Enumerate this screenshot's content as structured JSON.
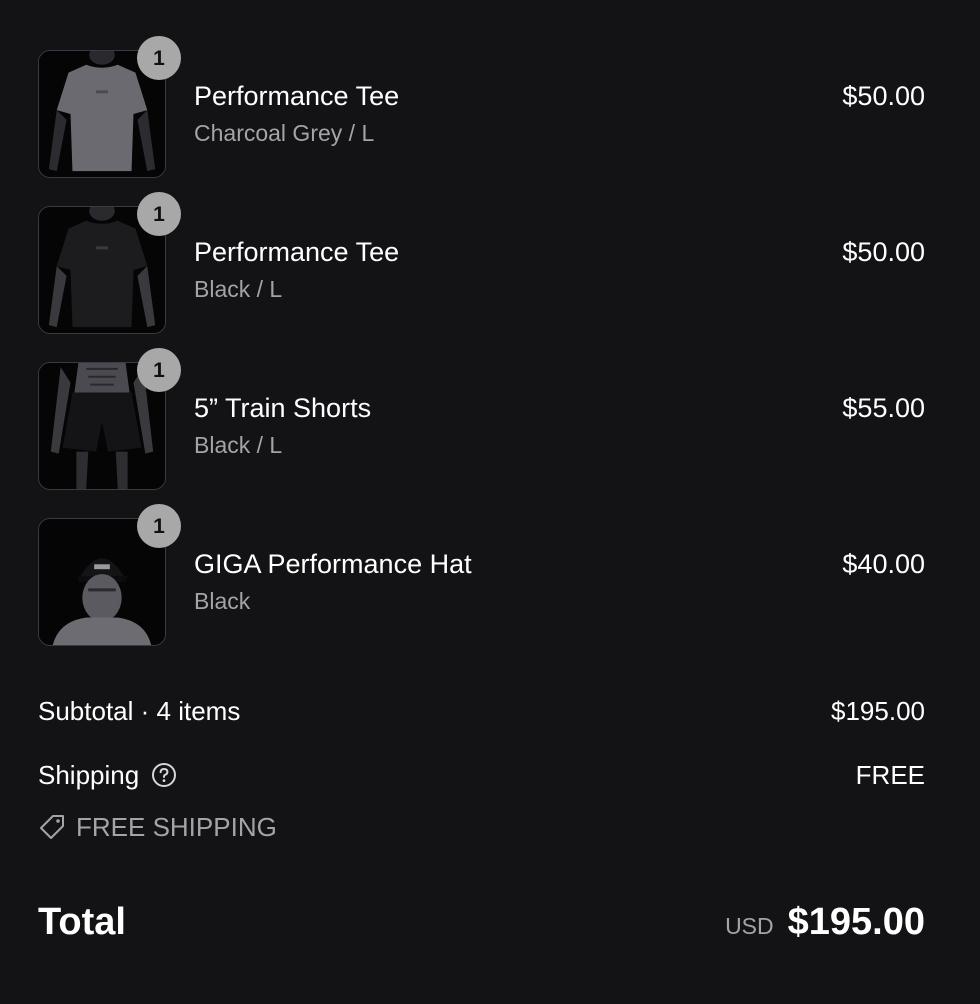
{
  "line_items": [
    {
      "quantity": "1",
      "name": "Performance Tee",
      "variant": "Charcoal Grey / L",
      "price": "$50.00",
      "image": "grey-tee-on-mannequin"
    },
    {
      "quantity": "1",
      "name": "Performance Tee",
      "variant": "Black / L",
      "price": "$50.00",
      "image": "black-tee-on-mannequin"
    },
    {
      "quantity": "1",
      "name": "5” Train Shorts",
      "variant": "Black / L",
      "price": "$55.00",
      "image": "black-shorts-on-mannequin"
    },
    {
      "quantity": "1",
      "name": "GIGA Performance Hat",
      "variant": "Black",
      "price": "$40.00",
      "image": "black-hat-on-mannequin"
    }
  ],
  "subtotal": {
    "label": "Subtotal · 4 items",
    "value": "$195.00"
  },
  "shipping": {
    "label": "Shipping",
    "value": "FREE",
    "help_icon": "question-circle-icon"
  },
  "discount": {
    "label": "FREE SHIPPING",
    "icon": "tag-icon"
  },
  "total": {
    "label": "Total",
    "currency": "USD",
    "value": "$195.00"
  },
  "colors": {
    "background": "#131316",
    "text": "#ffffff",
    "muted": "#a3a3a8",
    "badge": "#a8a8a8"
  }
}
